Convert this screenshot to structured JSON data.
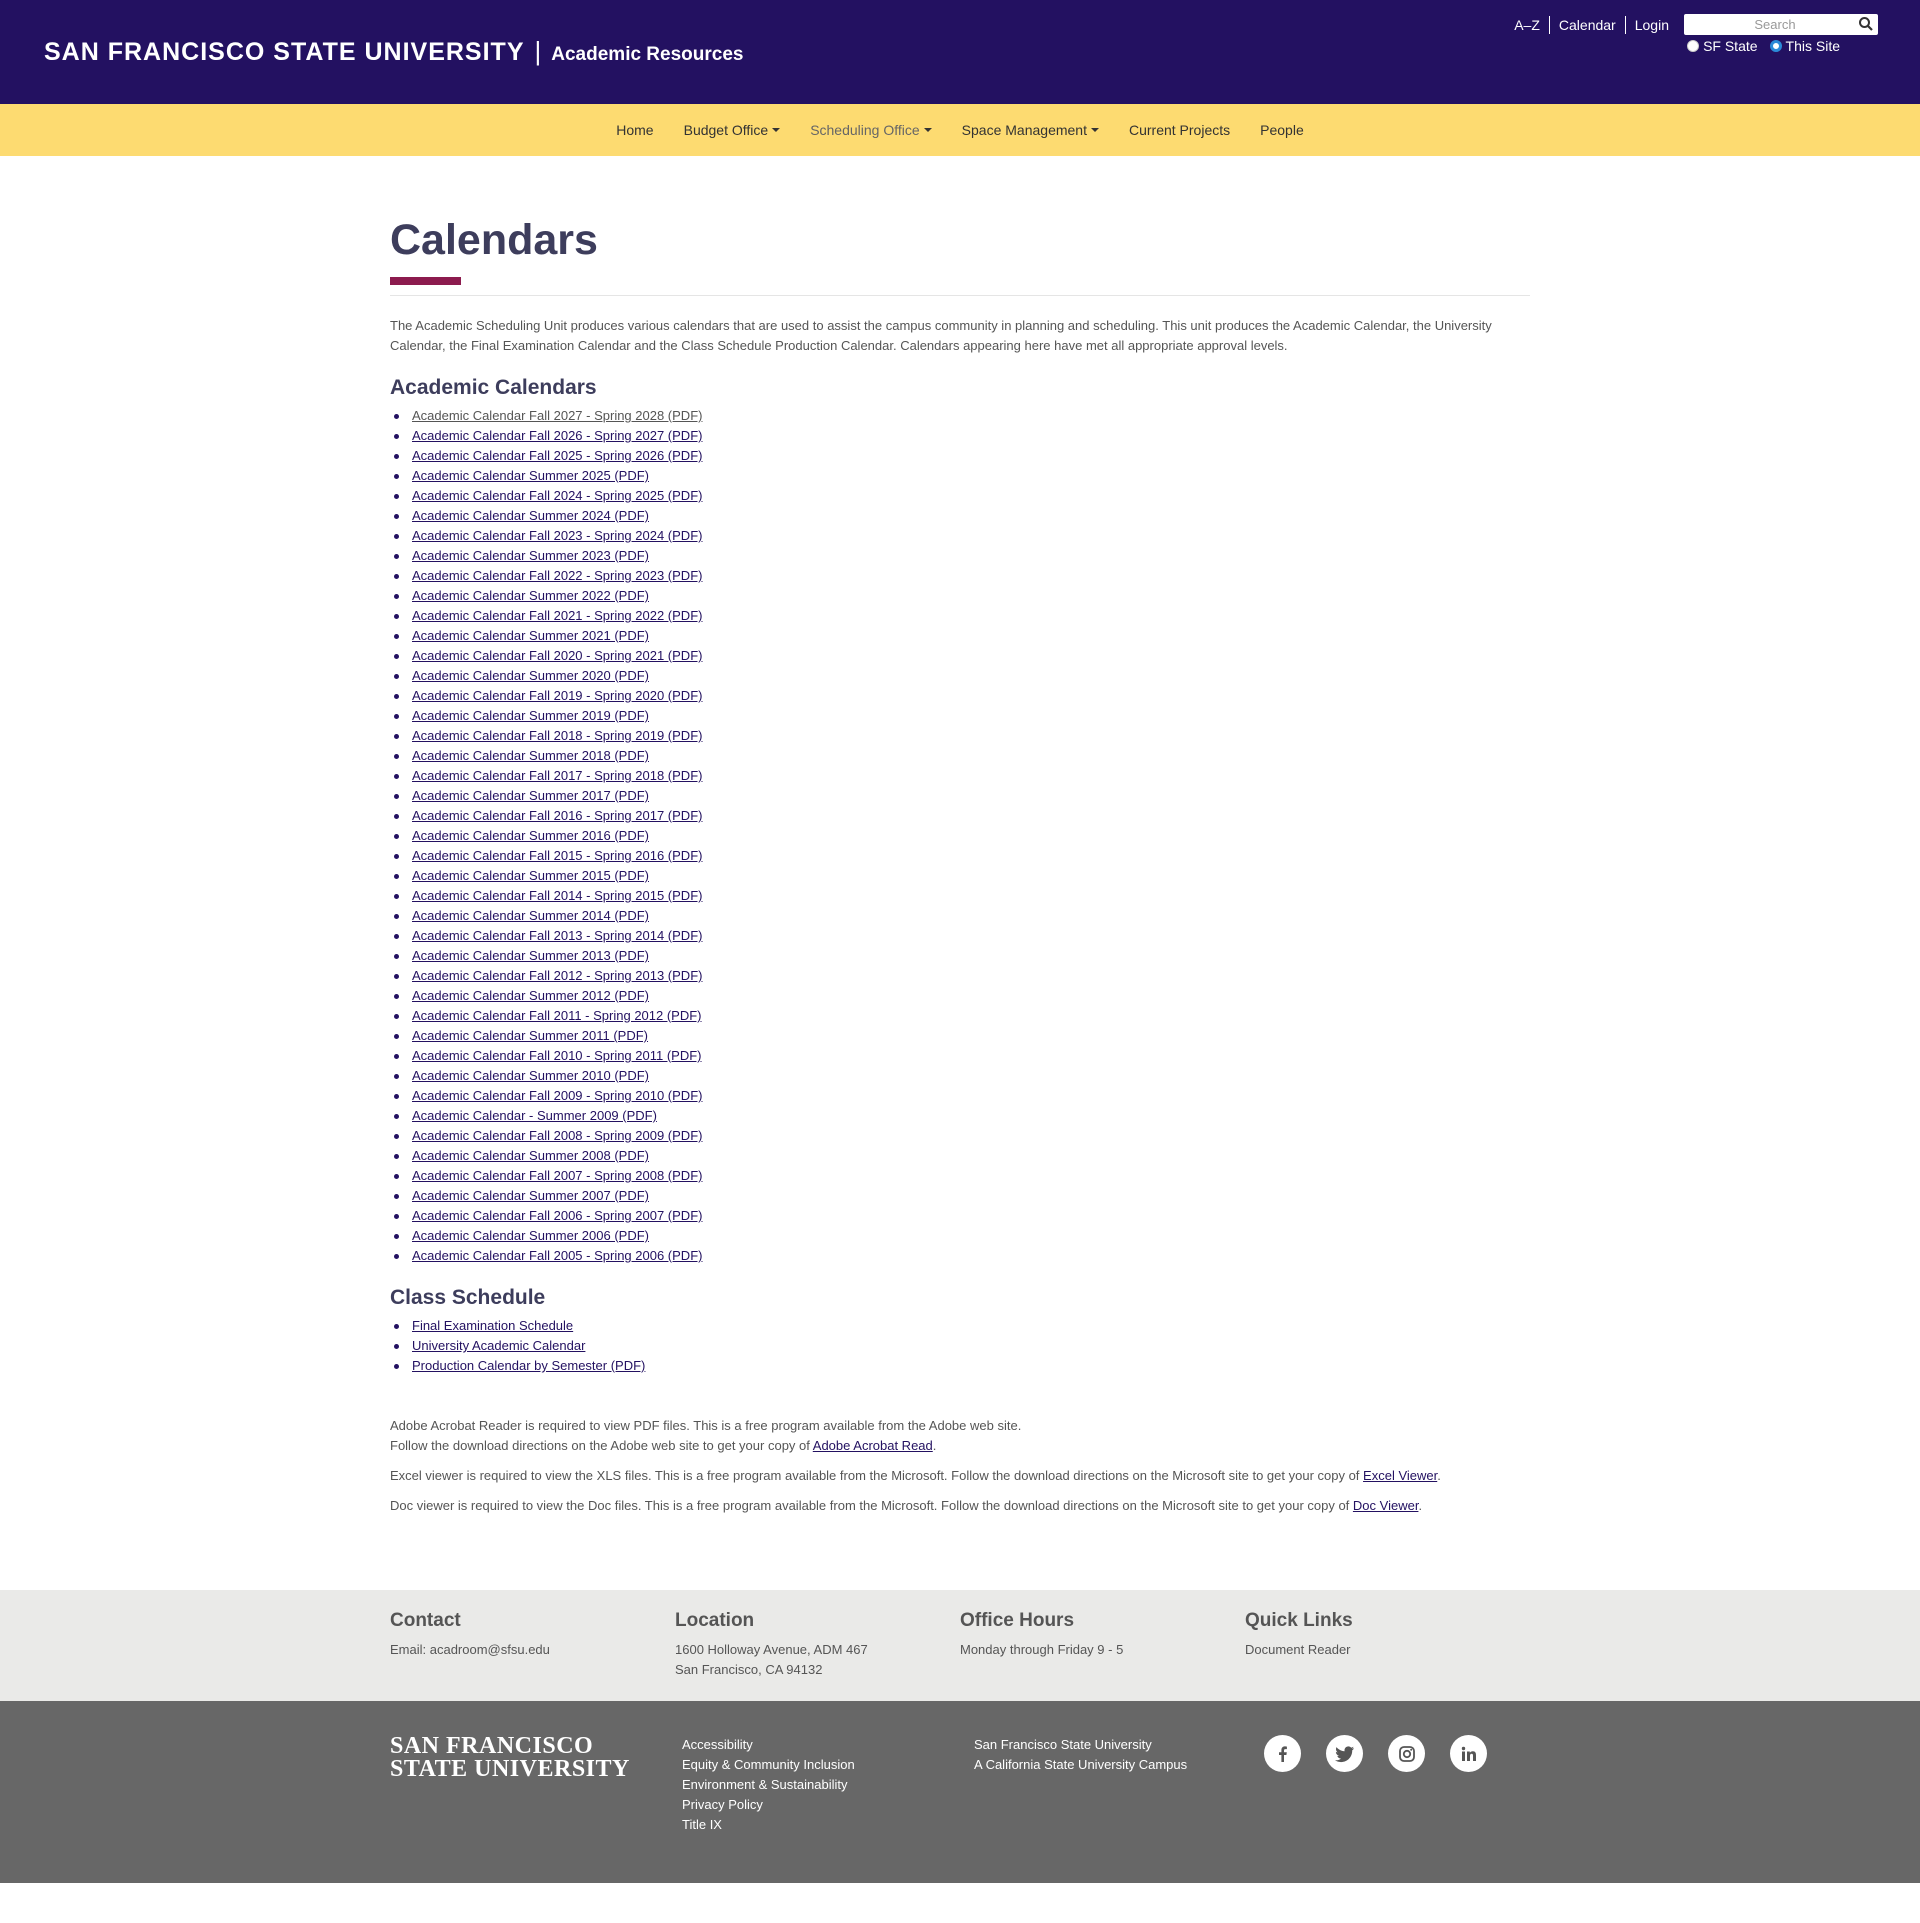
{
  "header": {
    "university": "SAN FRANCISCO STATE UNIVERSITY",
    "separator": "|",
    "site_name": "Academic Resources",
    "util_links": [
      "A–Z",
      "Calendar",
      "Login"
    ],
    "search_placeholder": "Search",
    "scope_options": [
      "SF State",
      "This Site"
    ],
    "scope_selected": "This Site"
  },
  "nav": {
    "items": [
      {
        "label": "Home"
      },
      {
        "label": "Budget Office"
      },
      {
        "label": "Scheduling Office"
      },
      {
        "label": "Space Management"
      },
      {
        "label": "Current Projects"
      },
      {
        "label": "People"
      }
    ]
  },
  "main": {
    "title": "Calendars",
    "intro": "The Academic Scheduling Unit produces various calendars that are used to assist the campus community in planning and scheduling. This unit produces the Academic Calendar, the University Calendar, the Final Examination Calendar and the Class Schedule Production Calendar. Calendars appearing here have met all appropriate approval levels.",
    "academic_heading": "Academic Calendars",
    "academic_links": [
      "Academic Calendar Fall 2027 - Spring 2028 (PDF)",
      "Academic Calendar Fall 2026 - Spring 2027 (PDF)",
      "Academic Calendar Fall 2025 - Spring 2026 (PDF)",
      "Academic Calendar Summer 2025 (PDF)",
      "Academic Calendar Fall 2024 - Spring 2025 (PDF)",
      "Academic Calendar Summer 2024 (PDF)",
      "Academic Calendar Fall 2023 - Spring 2024 (PDF)",
      "Academic Calendar Summer 2023 (PDF)",
      "Academic Calendar Fall 2022 - Spring 2023 (PDF)",
      "Academic Calendar Summer 2022 (PDF)",
      "Academic Calendar Fall 2021 - Spring 2022 (PDF)",
      "Academic Calendar Summer 2021 (PDF)",
      "Academic Calendar Fall 2020 - Spring 2021 (PDF)",
      "Academic Calendar Summer 2020 (PDF)",
      "Academic Calendar Fall 2019 - Spring 2020 (PDF)",
      "Academic Calendar Summer 2019 (PDF)",
      "Academic Calendar Fall 2018 - Spring 2019 (PDF)",
      "Academic Calendar Summer 2018 (PDF)",
      "Academic Calendar Fall 2017 - Spring 2018 (PDF)",
      "Academic Calendar Summer 2017 (PDF)",
      "Academic Calendar Fall 2016 - Spring 2017 (PDF)",
      "Academic Calendar Summer 2016 (PDF)",
      "Academic Calendar Fall 2015 - Spring 2016 (PDF)",
      "Academic Calendar Summer 2015 (PDF)",
      "Academic Calendar Fall 2014 - Spring 2015 (PDF)",
      "Academic Calendar Summer 2014 (PDF)",
      "Academic Calendar Fall 2013 - Spring 2014 (PDF)",
      "Academic Calendar Summer 2013 (PDF)",
      "Academic Calendar Fall 2012 - Spring 2013 (PDF)",
      "Academic Calendar Summer 2012 (PDF)",
      "Academic Calendar Fall 2011 - Spring 2012 (PDF)",
      "Academic Calendar Summer 2011 (PDF)",
      "Academic Calendar Fall 2010 - Spring 2011 (PDF)",
      "Academic Calendar Summer 2010 (PDF)",
      "Academic Calendar Fall 2009 - Spring 2010 (PDF)",
      "Academic Calendar - Summer 2009 (PDF)",
      "Academic Calendar Fall 2008 - Spring 2009 (PDF)",
      "Academic Calendar Summer 2008 (PDF)",
      "Academic Calendar Fall 2007 - Spring 2008 (PDF)",
      "Academic Calendar Summer 2007 (PDF)",
      "Academic Calendar Fall 2006 - Spring 2007 (PDF)",
      "Academic Calendar Summer 2006 (PDF)",
      "Academic Calendar Fall 2005 - Spring 2006 (PDF)"
    ],
    "class_heading": "Class Schedule",
    "class_links": [
      "Final Examination Schedule",
      "University Academic Calendar",
      "Production Calendar by Semester (PDF)"
    ],
    "notes": {
      "acrobat_text": "Adobe Acrobat Reader is required to view PDF files. This is a free program available from the Adobe web site. Follow the download directions on the Adobe web site to get your copy of ",
      "acrobat_link": "Adobe Acrobat Read",
      "excel_text": "Excel viewer is required to view the XLS files. This is a free program available from the Microsoft. Follow the download directions on the Microsoft site to get your copy of ",
      "excel_link": "Excel Viewer",
      "doc_text": "Doc viewer is required to view the Doc files. This is a free program available from the Microsoft. Follow the download directions on the Microsoft site to get your copy of ",
      "doc_link": "Doc Viewer",
      "period": "."
    }
  },
  "footer_info": {
    "contact_heading": "Contact",
    "contact_email": "Email: acadroom@sfsu.edu",
    "location_heading": "Location",
    "location_line1": "1600 Holloway Avenue, ADM 467",
    "location_line2": "San Francisco, CA 94132",
    "hours_heading": "Office Hours",
    "hours": "Monday through Friday 9 - 5",
    "quick_heading": "Quick Links",
    "quick_link": "Document Reader"
  },
  "footer_bottom": {
    "logo_line1": "SAN FRANCISCO",
    "logo_line2": "STATE UNIVERSITY",
    "links": [
      "Accessibility",
      "Equity & Community Inclusion",
      "Environment & Sustainability",
      "Privacy Policy",
      "Title IX"
    ],
    "info_line1": "San Francisco State University",
    "info_line2": "A California State University Campus",
    "social": [
      "facebook-icon",
      "twitter-icon",
      "instagram-icon",
      "linkedin-icon"
    ]
  }
}
